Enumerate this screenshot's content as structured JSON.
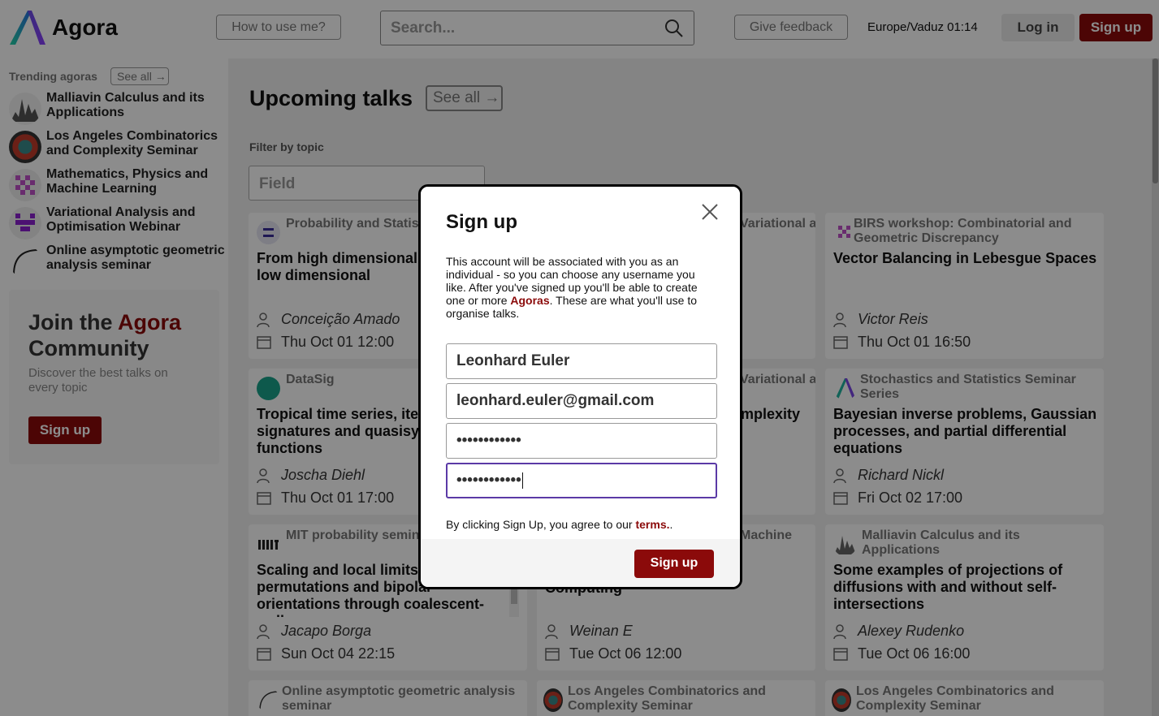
{
  "header": {
    "logo_text": "Agora",
    "how_label": "How to use me?",
    "search_placeholder": "Search...",
    "feedback_label": "Give feedback",
    "clock": "Europe/Vaduz 01:14",
    "login_label": "Log in",
    "signup_label": "Sign up"
  },
  "sidebar": {
    "trending_title": "Trending agoras",
    "see_all": "See all →",
    "items": [
      {
        "label": "Malliavin Calculus and its Applications"
      },
      {
        "label": "Los Angeles Combinatorics and Complexity Seminar"
      },
      {
        "label": "Mathematics, Physics and Machine Learning"
      },
      {
        "label": "Variational Analysis and Optimisation Webinar"
      },
      {
        "label": "Online asymptotic geometric analysis seminar"
      }
    ],
    "join": {
      "title_prefix": "Join the ",
      "title_accent": "Agora",
      "title_suffix": " Community",
      "subtitle": "Discover the best talks on every topic",
      "button": "Sign up"
    }
  },
  "main": {
    "title": "Upcoming talks",
    "see_all": "See all →",
    "filter_label": "Filter by topic",
    "field_placeholder": "Field",
    "cards": [
      {
        "agora": "Probability and Statistics (Lisbon)",
        "title": "From high dimensional to random low dimensional",
        "speaker": "Conceição Amado",
        "date": "Thu Oct 01 12:00"
      },
      {
        "agora": "Variational and",
        "title": "",
        "speaker": "",
        "date": ""
      },
      {
        "agora": "BIRS workshop: Combinatorial and Geometric Discrepancy",
        "title": "Vector Balancing in Lebesgue Spaces",
        "speaker": "Victor Reis",
        "date": "Thu Oct 01 16:50"
      },
      {
        "agora": "DataSig",
        "title": "Tropical time series, iterated signatures and quasisymmetric functions",
        "speaker": "Joscha Diehl",
        "date": "Thu Oct 01 17:00"
      },
      {
        "agora": "Variational and",
        "title": "complexity of",
        "speaker": "",
        "date": ""
      },
      {
        "agora": "Stochastics and Statistics Seminar Series",
        "title": "Bayesian inverse problems, Gaussian processes, and partial differential equations",
        "speaker": "Richard Nickl",
        "date": "Fri Oct 02 17:00"
      },
      {
        "agora": "MIT probability seminar",
        "title": "Scaling and local limits of permutations and bipolar orientations through coalescent-walk processes",
        "speaker": "Jacapo Borga",
        "date": "Sun Oct 04 22:15"
      },
      {
        "agora": "Machine",
        "title": "Computing",
        "speaker": "Weinan E",
        "date": "Tue Oct 06 12:00"
      },
      {
        "agora": "Malliavin Calculus and its Applications",
        "title": "Some examples of projections of diffusions with and without self-intersections",
        "speaker": "Alexey Rudenko",
        "date": "Tue Oct 06 16:00"
      },
      {
        "agora": "Online asymptotic geometric analysis seminar",
        "title": "",
        "speaker": "",
        "date": ""
      },
      {
        "agora": "Los Angeles Combinatorics and Complexity Seminar",
        "title": "",
        "speaker": "",
        "date": ""
      },
      {
        "agora": "Los Angeles Combinatorics and Complexity Seminar",
        "title": "",
        "speaker": "",
        "date": ""
      }
    ]
  },
  "modal": {
    "title": "Sign up",
    "description_prefix": "This account will be associated with you as an individual - so you can choose any username you like. After you've signed up you'll be able to create one or more ",
    "description_accent": "Agoras",
    "description_suffix": ". These are what you'll use to organise talks.",
    "name_value": "Leonhard Euler",
    "email_value": "leonhard.euler@gmail.com",
    "password_value": "••••••••••••",
    "confirm_value": "••••••••••••",
    "terms_prefix": "By clicking Sign Up, you agree to our ",
    "terms_link": "terms.",
    "terms_suffix": ".",
    "submit_label": "Sign up"
  },
  "colors": {
    "accent": "#8b0a0a",
    "focus": "#5b3aa6"
  }
}
